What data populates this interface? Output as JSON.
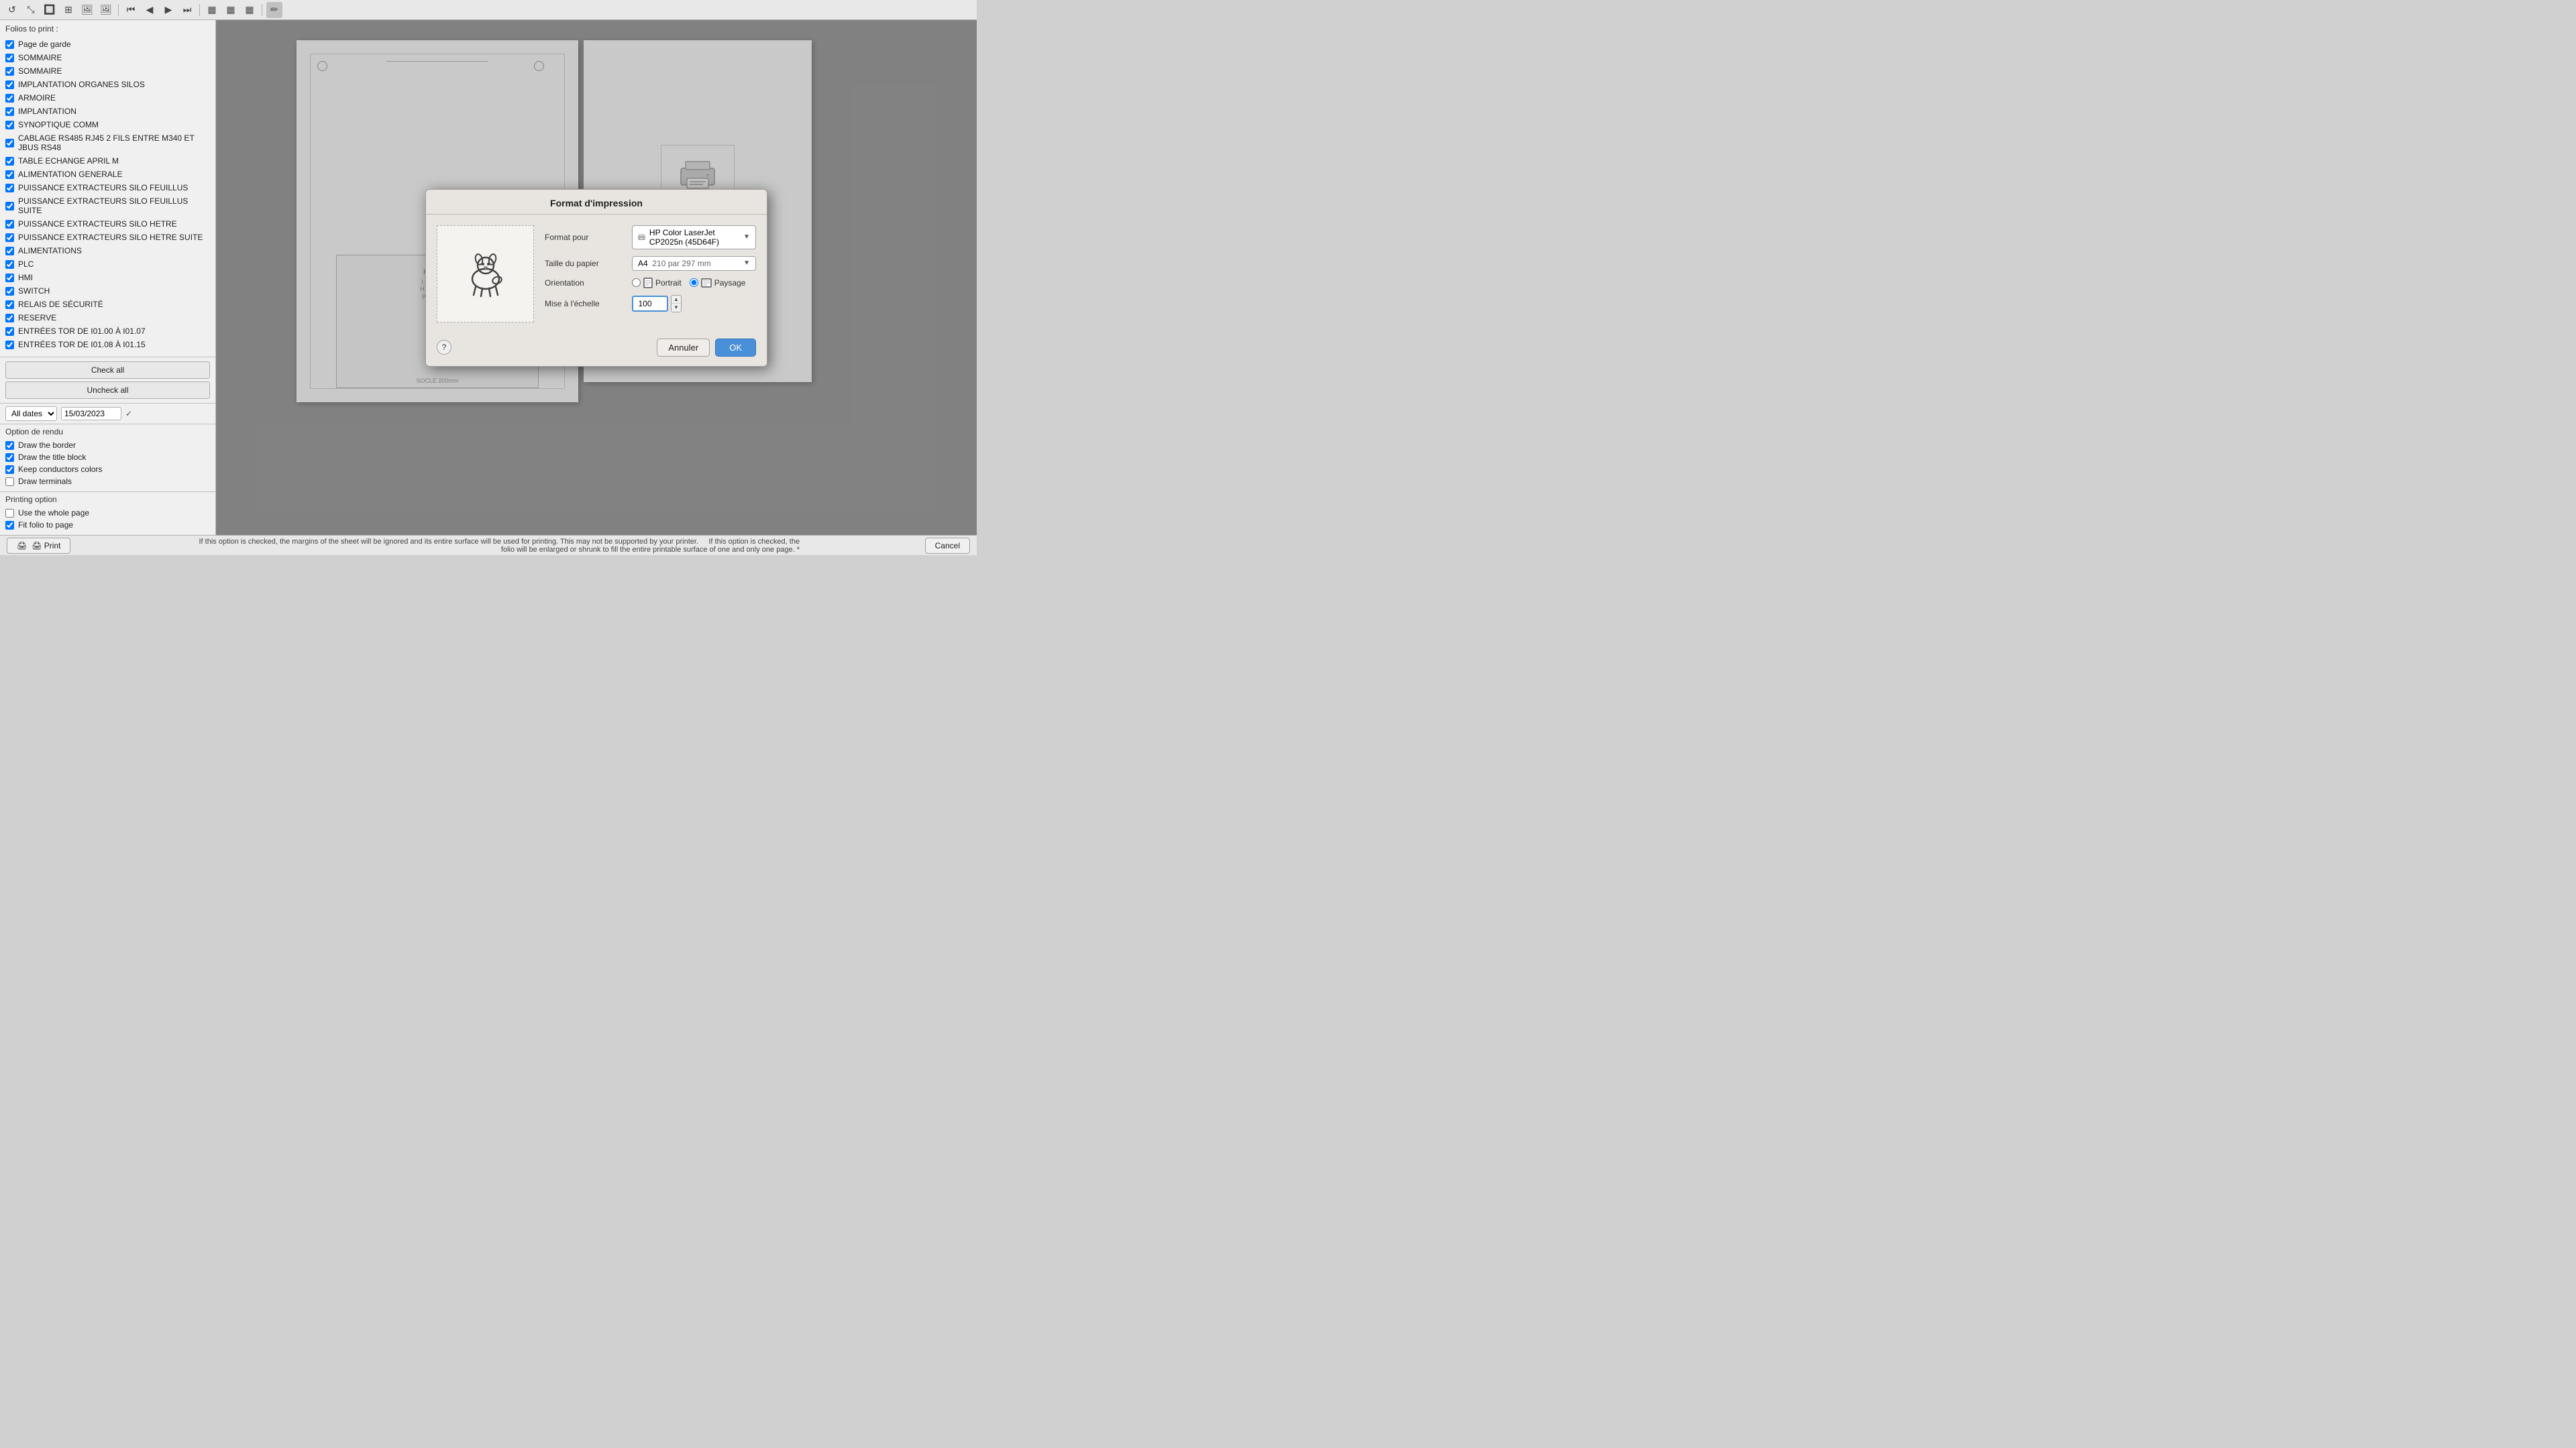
{
  "toolbar": {
    "buttons": [
      {
        "name": "reset-icon",
        "icon": "⟳",
        "title": "Reset"
      },
      {
        "name": "zoom-in-icon",
        "icon": "⊕",
        "title": "Zoom In"
      },
      {
        "name": "zoom-out-icon",
        "icon": "⊖",
        "title": "Zoom Out"
      },
      {
        "name": "zoom-fit-icon",
        "icon": "⤢",
        "title": "Fit"
      },
      {
        "name": "image-icon",
        "icon": "🖼",
        "title": "Image"
      },
      {
        "name": "image2-icon",
        "icon": "🖼",
        "title": "Image2"
      },
      {
        "name": "nav-first-icon",
        "icon": "⏮",
        "title": "First"
      },
      {
        "name": "nav-prev-icon",
        "icon": "◀",
        "title": "Previous"
      },
      {
        "name": "nav-next-icon",
        "icon": "▶",
        "title": "Next"
      },
      {
        "name": "nav-last-icon",
        "icon": "⏭",
        "title": "Last"
      },
      {
        "name": "grid1-icon",
        "icon": "▦",
        "title": "Grid1"
      },
      {
        "name": "grid2-icon",
        "icon": "▦",
        "title": "Grid2"
      },
      {
        "name": "grid3-icon",
        "icon": "▦",
        "title": "Grid3"
      },
      {
        "name": "edit-icon",
        "icon": "✏️",
        "title": "Edit",
        "active": true
      }
    ]
  },
  "sidebar": {
    "header": "Folios to print :",
    "items": [
      {
        "label": "Page de garde",
        "checked": true
      },
      {
        "label": "SOMMAIRE",
        "checked": true
      },
      {
        "label": "SOMMAIRE",
        "checked": true
      },
      {
        "label": "IMPLANTATION ORGANES SILOS",
        "checked": true
      },
      {
        "label": "ARMOIRE",
        "checked": true
      },
      {
        "label": "IMPLANTATION",
        "checked": true
      },
      {
        "label": "SYNOPTIQUE COMM",
        "checked": true
      },
      {
        "label": "CABLAGE RS485 RJ45 2 FILS ENTRE M340 ET JBUS RS48",
        "checked": true
      },
      {
        "label": "TABLE ECHANGE APRIL M",
        "checked": true
      },
      {
        "label": "ALIMENTATION GENERALE",
        "checked": true
      },
      {
        "label": "PUISSANCE EXTRACTEURS SILO FEUILLUS",
        "checked": true
      },
      {
        "label": "PUISSANCE EXTRACTEURS SILO FEUILLUS SUITE",
        "checked": true
      },
      {
        "label": "PUISSANCE EXTRACTEURS SILO HETRE",
        "checked": true
      },
      {
        "label": "PUISSANCE EXTRACTEURS SILO HETRE SUITE",
        "checked": true
      },
      {
        "label": "ALIMENTATIONS",
        "checked": true
      },
      {
        "label": "PLC",
        "checked": true
      },
      {
        "label": "HMI",
        "checked": true
      },
      {
        "label": "SWITCH",
        "checked": true
      },
      {
        "label": "RELAIS DE SÉCURITÉ",
        "checked": true
      },
      {
        "label": "RESERVE",
        "checked": true
      },
      {
        "label": "ENTRÉES TOR DE I01.00 À I01.07",
        "checked": true
      },
      {
        "label": "ENTRÉES TOR DE I01.08 À I01.15",
        "checked": true
      }
    ],
    "check_all_label": "Check all",
    "uncheck_all_label": "Uncheck all",
    "date_filter": {
      "select_options": [
        "All dates"
      ],
      "selected": "All dates",
      "date_value": "15/03/2023"
    }
  },
  "render_options": {
    "title": "Option de rendu",
    "items": [
      {
        "label": "Draw the border",
        "checked": true
      },
      {
        "label": "Draw the title block",
        "checked": true
      },
      {
        "label": "Keep conductors colors",
        "checked": true
      },
      {
        "label": "Draw terminals",
        "checked": false
      }
    ]
  },
  "print_options": {
    "title": "Printing option",
    "items": [
      {
        "label": "Use the whole page",
        "checked": false,
        "hint": "If this option is checked, the margins of the sheet will be ignored and its entire surface will be used for printing. This may not be supported by your printer."
      },
      {
        "label": "Fit folio to page",
        "checked": true,
        "hint": "If this option is checked, the folio will be enlarged or shrunk to fill the entire printable surface of one and only one page. *"
      }
    ]
  },
  "bottom_bar": {
    "print_label": "🖨 Print",
    "cancel_label": "Cancel"
  },
  "modal": {
    "title": "Format d'impression",
    "format_pour_label": "Format pour",
    "printer_name": "HP Color LaserJet CP2025n (45D64F)",
    "taille_label": "Taille du papier",
    "paper_size": "A4",
    "paper_dims": "210 par 297 mm",
    "orientation_label": "Orientation",
    "portrait_label": "Portrait",
    "paysage_label": "Paysage",
    "orientation_selected": "paysage",
    "mise_echelle_label": "Mise à l'échelle",
    "scale_value": "100",
    "annuler_label": "Annuler",
    "ok_label": "OK",
    "help_label": "?"
  }
}
